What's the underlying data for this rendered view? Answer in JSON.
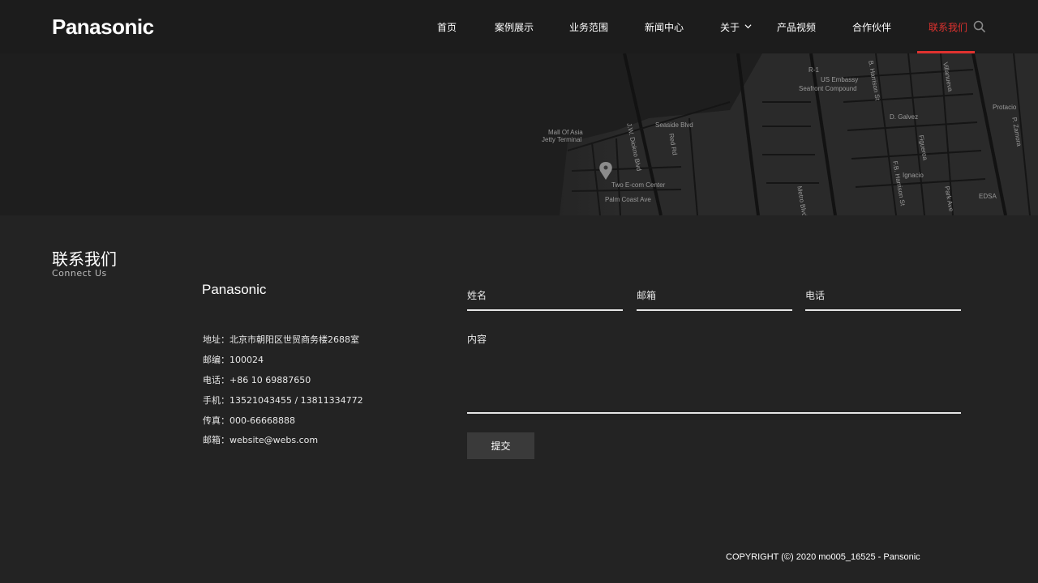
{
  "header": {
    "logo": "Panasonic",
    "nav": [
      {
        "label": "首页"
      },
      {
        "label": "案例展示"
      },
      {
        "label": "业务范围"
      },
      {
        "label": "新闻中心"
      },
      {
        "label": "关于"
      },
      {
        "label": "产品视频"
      },
      {
        "label": "合作伙伴"
      },
      {
        "label": "联系我们",
        "active": true
      }
    ],
    "icons": {
      "dropdown": "chevron-down-icon",
      "search": "search-icon"
    },
    "accent_color": "#e0322f"
  },
  "map": {
    "labels": [
      "US Embassy",
      "Seafront Compound",
      "Mall Of Asia",
      "Jetty Terminal",
      "Seaside Blvd",
      "J.W. Diokno Blvd",
      "Two E-com Center",
      "Palm Coast Ave",
      "B. Harrison St",
      "F.B. Harrison St",
      "D. Galvez",
      "Figueroa",
      "Ignacio",
      "Villanueva",
      "Protacio",
      "P. Zamora",
      "Park Ave",
      "EDSA",
      "Metro Blvd",
      "Red Rd",
      "R-1"
    ],
    "marker_icon": "map-pin-icon"
  },
  "contact": {
    "title": "联系我们",
    "subtitle": "Connect Us",
    "company": "Panasonic",
    "info": [
      "地址：北京市朝阳区世贸商务楼2688室",
      "邮编：100024",
      "电话：+86  10 69887650",
      "手机：13521043455 / 13811334772",
      "传真：000-66668888",
      "邮箱：website@webs.com"
    ]
  },
  "form": {
    "name_placeholder": "姓名",
    "email_placeholder": "邮箱",
    "phone_placeholder": "电话",
    "message_placeholder": "内容",
    "submit_label": "提交"
  },
  "footer": {
    "copyright": "COPYRIGHT (©) 2020 mo005_16525 - Pansonic"
  }
}
